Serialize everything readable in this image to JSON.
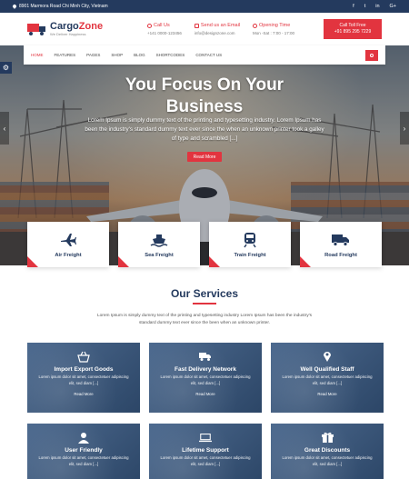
{
  "topbar": {
    "address": "8901 Marmora Road Chi Minh City, Vietnam",
    "social": [
      "f",
      "t",
      "in",
      "G+"
    ]
  },
  "header": {
    "logo_name_1": "Cargo",
    "logo_name_2": "Zone",
    "logo_tagline": "We Deliver Happiness",
    "call_label": "Call Us",
    "call_value": "+141 0000-123456",
    "email_label": "Send us an Email",
    "email_value": "info@designzone.com",
    "hours_label": "Opening Time",
    "hours_value": "Mon -Sat : 7:00 - 17:00",
    "tollfree_label": "Call Toll Free",
    "tollfree_value": "+91 895 295 7229"
  },
  "nav": {
    "items": [
      "HOME",
      "FEATURES",
      "PAGES",
      "SHOP",
      "BLOG",
      "SHORTCODES",
      "CONTACT US"
    ],
    "active": "HOME"
  },
  "hero": {
    "title_line1": "You Focus On Your",
    "title_line2": "Business",
    "text": "Lorem Ipsum is simply dummy text of the printing and typesetting industry. Lorem Ipsum has been the industry's standard dummy text ever since the when an unknown printer took a galley of type and scrambled [...]",
    "button": "Read More",
    "prev": "‹",
    "next": "›"
  },
  "freight": [
    {
      "label": "Air Freight",
      "icon": "plane-icon"
    },
    {
      "label": "Sea Freight",
      "icon": "ship-icon"
    },
    {
      "label": "Train Freight",
      "icon": "train-icon"
    },
    {
      "label": "Road Freight",
      "icon": "truck-icon"
    }
  ],
  "services": {
    "title": "Our Services",
    "intro": "Lorem Ipsum is simply dummy text of the printing and typesetting industry Lorem Ipsum has been the industry's standard dummy text ever since the been when an unknown printer.",
    "items": [
      {
        "name": "Import Export Goods",
        "desc": "Lorem ipsum dolor sit amet, consectetuer adipiscing elit, sed diam [...]",
        "more": "Read More",
        "icon": "basket-icon"
      },
      {
        "name": "Fast Delivery Network",
        "desc": "Lorem ipsum dolor sit amet, consectetuer adipiscing elit, sed diam [...]",
        "more": "Read More",
        "icon": "truck-icon"
      },
      {
        "name": "Well Qualified Staff",
        "desc": "Lorem ipsum dolor sit amet, consectetuer adipiscing elit, sed diam [...]",
        "more": "Read More",
        "icon": "location-pin-icon"
      },
      {
        "name": "User Friendly",
        "desc": "Lorem ipsum dolor sit amet, consectetuer adipiscing elit, sed diam [...]",
        "more": "",
        "icon": "user-icon"
      },
      {
        "name": "Lifetime Support",
        "desc": "Lorem ipsum dolor sit amet, consectetuer adipiscing elit, sed diam [...]",
        "more": "",
        "icon": "laptop-icon"
      },
      {
        "name": "Great Discounts",
        "desc": "Lorem ipsum dolor sit amet, consectetuer adipiscing elit, sed diam [...]",
        "more": "",
        "icon": "gift-icon"
      }
    ]
  },
  "colors": {
    "primary": "#243a5e",
    "accent": "#e2343f"
  }
}
